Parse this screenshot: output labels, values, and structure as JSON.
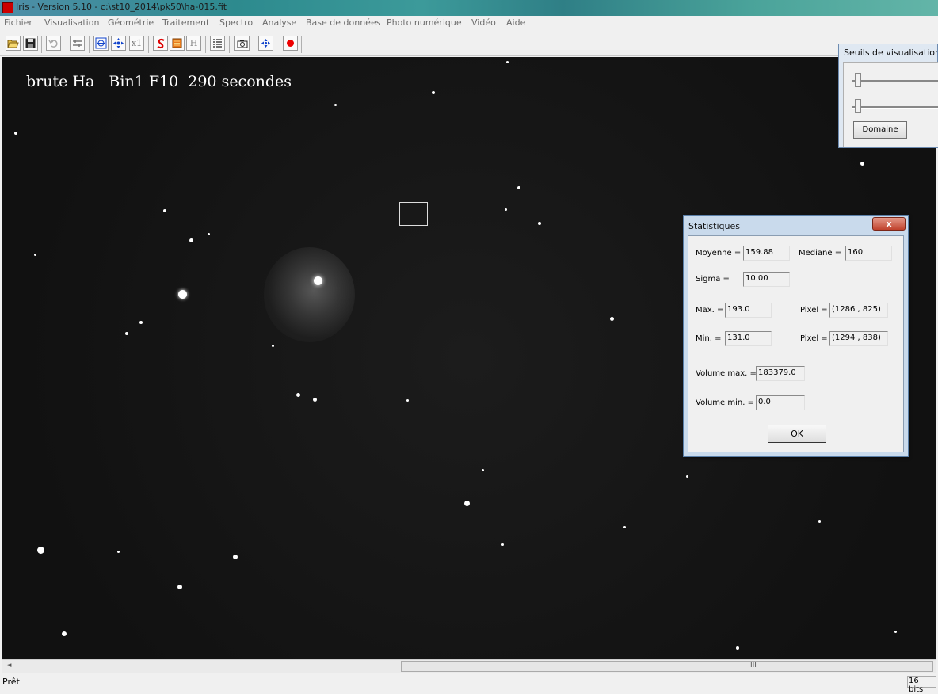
{
  "window": {
    "title": "Iris - Version 5.10 - c:\\st10_2014\\pk50\\ha-015.fit"
  },
  "menu": [
    "Fichier",
    "Visualisation",
    "Géométrie",
    "Traitement",
    "Spectro",
    "Analyse",
    "Base de données",
    "Photo numérique",
    "Vidéo",
    "Aide"
  ],
  "toolbar": {
    "icons": [
      "open-folder-icon",
      "save-icon",
      "undo-icon",
      "threshold-icon",
      "zoom-in-icon",
      "pan-icon",
      "zoom-1x-icon",
      "spectrum-icon",
      "palette-icon",
      "histogram-icon",
      "console-icon",
      "camera-icon",
      "center-icon",
      "record-icon"
    ],
    "zoom_1x_label": "x1",
    "histogram_label": "H"
  },
  "image": {
    "overlay_text": "brute Ha   Bin1 F10  290 secondes"
  },
  "seuils": {
    "title": "Seuils de visualisation",
    "domaine_label": "Domaine"
  },
  "stats": {
    "title": "Statistiques",
    "close_label": "x",
    "moyenne_label": "Moyenne =",
    "moyenne_value": "159.88",
    "mediane_label": "Mediane =",
    "mediane_value": "160",
    "sigma_label": "Sigma =",
    "sigma_value": "10.00",
    "max_label": "Max. =",
    "max_value": "193.0",
    "max_pixel_label": "Pixel =",
    "max_pixel_value": "(1286 , 825)",
    "min_label": "Min. =",
    "min_value": "131.0",
    "min_pixel_label": "Pixel =",
    "min_pixel_value": "(1294 , 838)",
    "volmax_label": "Volume max. =",
    "volmax_value": "183379.0",
    "volmin_label": "Volume min. =",
    "volmin_value": "0.0",
    "ok_label": "OK"
  },
  "scrollbar": {
    "left_arrow": "◄",
    "grip": "III"
  },
  "status": {
    "left": "Prêt",
    "right": "16 bits"
  },
  "colors": {
    "titlebar": "#2d8a8e",
    "image_background": "#141414",
    "dialog_frame": "#c9daec",
    "close_button": "#c0412c"
  }
}
